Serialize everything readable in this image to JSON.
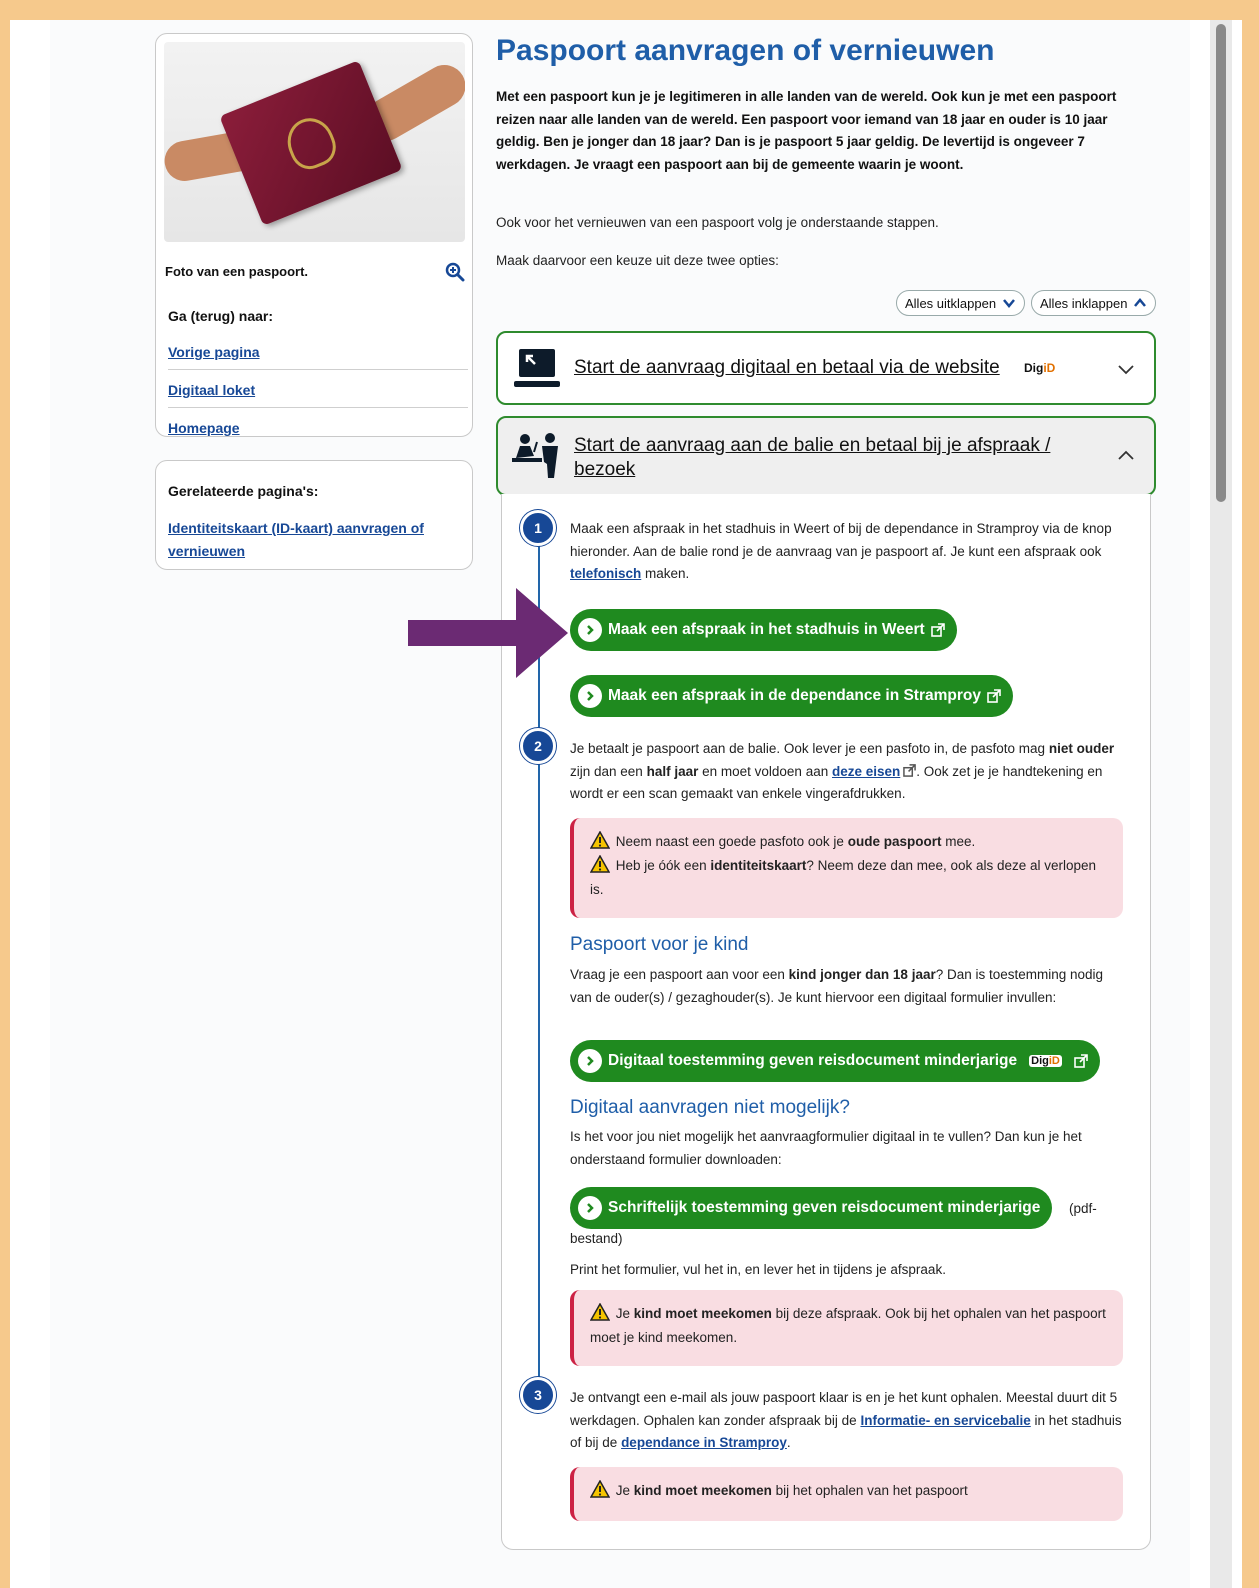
{
  "sidebar": {
    "photo_caption": "Foto van een paspoort.",
    "nav_heading": "Ga (terug) naar:",
    "links": [
      "Vorige pagina",
      "Digitaal loket",
      "Homepage"
    ],
    "related_heading": "Gerelateerde pagina's:",
    "related_link": "Identiteitskaart (ID-kaart) aanvragen of vernieuwen"
  },
  "main": {
    "title": "Paspoort aanvragen of vernieuwen",
    "intro": "Met een paspoort kun je je legitimeren in alle landen van de wereld. Ook kun je met een paspoort reizen naar alle landen van de wereld. Een paspoort voor iemand van 18 jaar en ouder is 10 jaar geldig. Ben je jonger dan 18 jaar? Dan is je paspoort 5 jaar geldig. De levertijd is ongeveer 7 werkdagen. Je vraagt een paspoort aan bij de gemeente waarin je woont.",
    "p1": "Ook voor het vernieuwen van een paspoort volg je onderstaande stappen.",
    "p2": "Maak daarvoor een keuze uit deze twee opties:",
    "expand_all": "Alles uitklappen",
    "collapse_all": "Alles inklappen"
  },
  "accordion": {
    "digital_title": "Start de aanvraag digitaal en betaal via de website",
    "counter_title_1": "Start de aanvraag aan de balie en betaal bij je afspraak /",
    "counter_title_2": "bezoek",
    "digid_prefix": "Dig",
    "digid_suffix": "iD"
  },
  "steps": {
    "n1": "1",
    "n2": "2",
    "n3": "3",
    "s1_text": "Maak een afspraak in het stadhuis in Weert of bij de dependance in Stramproy via de knop hieronder. Aan de balie rond je de aanvraag van je paspoort af. Je kunt een afspraak ook",
    "s1_link": "telefonisch",
    "s1_end": "maken.",
    "btn_weert": "Maak een afspraak in het stadhuis in Weert",
    "btn_stramproy": "Maak een afspraak in de dependance in Stramproy",
    "s2_a": "Je betaalt je paspoort aan de balie. Ook lever je een pasfoto in, de pasfoto mag",
    "s2_bold1": "niet ouder",
    "s2_b": "zijn dan een",
    "s2_bold2": "half jaar",
    "s2_c": "en moet voldoen aan",
    "s2_link": "deze eisen",
    "s2_d": ". Ook zet je je handtekening en wordt er een scan gemaakt van enkele vingerafdrukken.",
    "w1_a": "Neem naast een goede pasfoto ook je",
    "w1_bold": "oude paspoort",
    "w1_b": "mee.",
    "w2_a": "Heb je óók een",
    "w2_bold": "identiteitskaart",
    "w2_b": "? Neem deze dan mee, ook als deze al verlopen is.",
    "kid_heading": "Paspoort voor je kind",
    "kid_a": "Vraag je een paspoort aan voor een",
    "kid_bold": "kind jonger dan 18 jaar",
    "kid_b": "? Dan is toestemming nodig van de ouder(s) / gezaghouder(s). Je kunt hiervoor een digitaal formulier invullen:",
    "btn_digital_consent": "Digitaal toestemming geven reisdocument minderjarige",
    "not_possible_heading": "Digitaal aanvragen niet mogelijk?",
    "not_possible_text": "Is het voor jou niet mogelijk het aanvraagformulier digitaal in te vullen? Dan kun je het onderstaand formulier downloaden:",
    "btn_written_consent": "Schriftelijk toestemming geven reisdocument minderjarige",
    "pdf_a": "(pdf-",
    "pdf_b": "bestand)",
    "print_text": "Print het formulier, vul het in, en lever het in tijdens je afspraak.",
    "w3_a": "Je",
    "w3_bold": "kind moet meekomen",
    "w3_b": "bij deze afspraak. Ook bij het ophalen van het paspoort moet je kind meekomen.",
    "s3_a": "Je ontvangt een e-mail als jouw paspoort klaar is en je het kunt ophalen. Meestal duurt dit 5 werkdagen. Ophalen kan zonder afspraak bij de",
    "s3_link1": "Informatie- en servicebalie",
    "s3_b": "in het stadhuis of bij de",
    "s3_link2": "dependance in Stramproy",
    "s3_c": ".",
    "w4_a": "Je",
    "w4_bold": "kind moet meekomen",
    "w4_b": "bij het ophalen van het paspoort"
  },
  "colors": {
    "accent_blue": "#1f5ea8",
    "button_green": "#1f8a1f",
    "warning_bg": "#f9dde2",
    "annotation_arrow": "#6b2a73"
  }
}
